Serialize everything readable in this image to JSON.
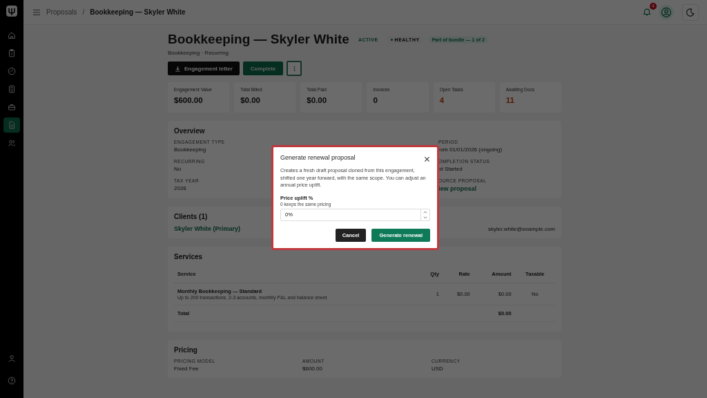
{
  "sidebar": {
    "items": [
      {
        "selected": false
      },
      {
        "selected": false
      },
      {
        "selected": false
      },
      {
        "selected": false
      },
      {
        "selected": false
      },
      {
        "selected": true
      },
      {
        "selected": false
      }
    ],
    "bottom_items": [
      {
        "selected": false
      },
      {
        "selected": false
      }
    ]
  },
  "topbar": {
    "breadcrumb": [
      "Proposals",
      "Bookkeeping — Skyler White"
    ],
    "separator": "/",
    "notification_count": "4"
  },
  "header": {
    "title": "Bookkeeping — Skyler White",
    "subtitle": "Bookkeeping · Recurring",
    "badges": [
      {
        "kind": "plain",
        "label": "ACTIVE"
      },
      {
        "kind": "dot",
        "label": "HEALTHY"
      },
      {
        "kind": "tint",
        "label": "Part of bundle — 1 of 2"
      }
    ],
    "actions": [
      {
        "kind": "dark",
        "label": "Engagement letter"
      },
      {
        "kind": "green",
        "label": "Complete"
      },
      {
        "kind": "more"
      }
    ]
  },
  "stats": [
    {
      "label": "Engagement Value",
      "value": "$600.00",
      "kind": "normal"
    },
    {
      "label": "Total Billed",
      "value": "$0.00",
      "kind": "normal"
    },
    {
      "label": "Total Paid",
      "value": "$0.00",
      "kind": "normal"
    },
    {
      "label": "Invoices",
      "value": "0",
      "kind": "normal"
    },
    {
      "label": "Open Tasks",
      "value": "4",
      "kind": "warning"
    },
    {
      "label": "Awaiting Docs",
      "value": "11",
      "kind": "warning"
    }
  ],
  "overview": {
    "title": "Overview",
    "left": [
      {
        "label": "ENGAGEMENT TYPE",
        "value": "Bookkeeping"
      },
      {
        "label": "RECURRING",
        "value": "No"
      },
      {
        "label": "TAX YEAR",
        "value": "2026"
      }
    ],
    "right": [
      {
        "label": "PERIOD",
        "value": "rom 01/01/2026 (ongoing)"
      },
      {
        "label": "OMPLETION STATUS",
        "value": "ot Started"
      },
      {
        "label": "OURCE PROPOSAL",
        "value": "iew proposal",
        "kind": "link"
      }
    ]
  },
  "clients": {
    "title": "Clients (1)",
    "name": "Skyler White (Primary)",
    "email": "skyler.white@example.com"
  },
  "services": {
    "title": "Services",
    "columns": [
      "Service",
      "Qty",
      "Rate",
      "Amount",
      "Taxable"
    ],
    "rows": [
      {
        "name": "Monthly Bookkeeping — Standard",
        "description": "Up to 200 transactions, 2-3 accounts, monthly P&L and balance sheet",
        "qty": "1",
        "rate": "$0.00",
        "amount": "$0.00",
        "taxable": "No"
      }
    ],
    "total_label": "Total",
    "total_amount": "$0.00"
  },
  "pricing": {
    "title": "Pricing",
    "fields": [
      {
        "label": "PRICING MODEL",
        "value": "Fixed Fee"
      },
      {
        "label": "AMOUNT",
        "value": "$600.00"
      },
      {
        "label": "CURRENCY",
        "value": "USD"
      }
    ]
  },
  "dialog": {
    "title": "Generate renewal proposal",
    "description": "Creates a fresh draft proposal cloned from this engagement, shifted one year forward, with the same scope. You can adjust an annual price uplift.",
    "field_label": "Price uplift %",
    "field_hint": "0 keeps the same pricing",
    "field_value": "0%",
    "buttons": [
      {
        "kind": "secondary",
        "label": "Cancel"
      },
      {
        "kind": "primary",
        "label": "Generate renewal"
      }
    ]
  }
}
